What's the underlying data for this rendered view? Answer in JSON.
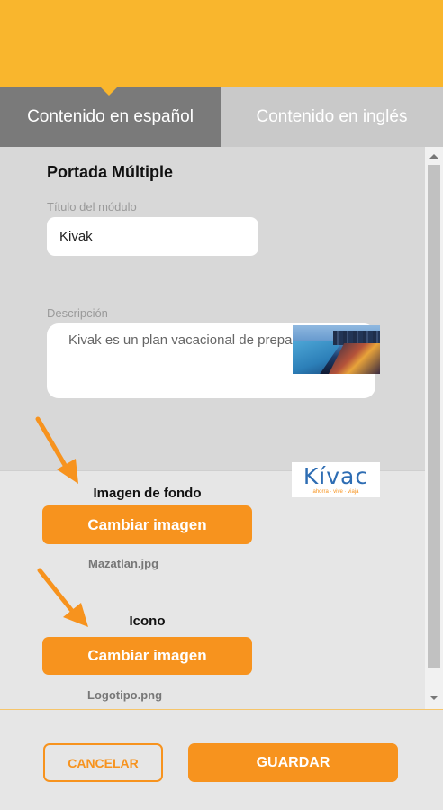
{
  "tabs": {
    "spanish": "Contenido en español",
    "english": "Contenido en inglés"
  },
  "module": {
    "section_title": "Portada Múltiple",
    "title_label": "Título del módulo",
    "title_value": "Kivak",
    "description_label": "Descripción",
    "description_value": "Kivak es un plan vacacional de prepago"
  },
  "background_image": {
    "heading": "Imagen de fondo",
    "button_label": "Cambiar imagen",
    "file_name": "Mazatlan.jpg"
  },
  "icon_image": {
    "heading": "Icono",
    "button_label": "Cambiar imagen",
    "file_name": "Logotipo.png",
    "logo_text": "Kívac",
    "logo_tagline": "ahorra · vive · viaja"
  },
  "footer": {
    "cancel_label": "CANCELAR",
    "save_label": "GUARDAR"
  },
  "colors": {
    "header": "#f9b62d",
    "accent": "#f7931e",
    "active_tab": "#7a7a7a",
    "inactive_tab": "#c9c9c9"
  },
  "icons": [
    "arrow-annotation-icon",
    "scroll-up-icon",
    "scroll-down-icon"
  ]
}
